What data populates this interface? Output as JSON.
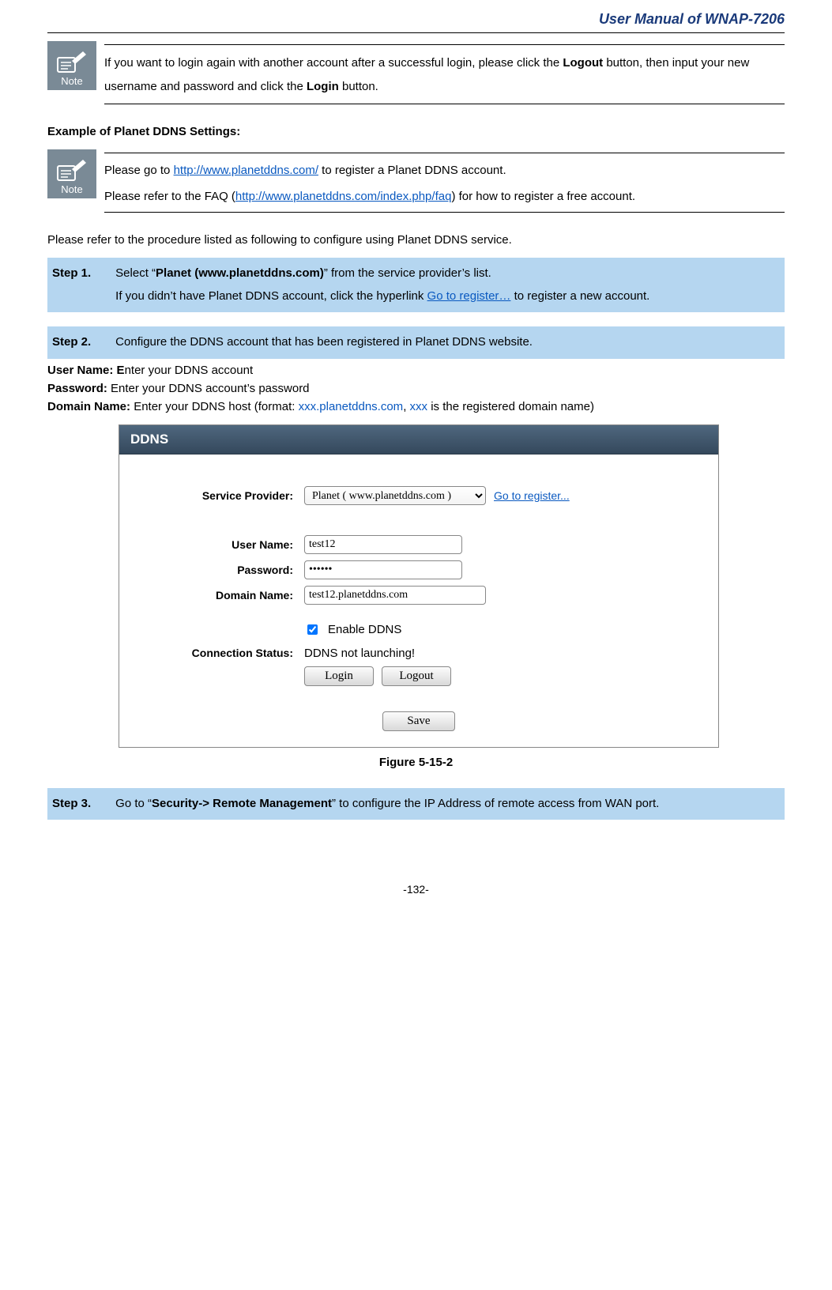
{
  "header": {
    "doc_title": "User Manual of WNAP-7206"
  },
  "note1": {
    "icon_label": "Note",
    "text_before": "If you want to login again with another account after a successful login, please click the ",
    "logout_word": "Logout",
    "text_mid": " button, then input your new username and password and click the ",
    "login_word": "Login",
    "text_after": " button."
  },
  "section_title": "Example of Planet DDNS Settings:",
  "note2": {
    "icon_label": "Note",
    "line1_before": "Please go to ",
    "line1_link": "http://www.planetddns.com/",
    "line1_after": " to register a Planet DDNS account.",
    "line2_before": "Please refer to the FAQ (",
    "line2_link": "http://www.planetddns.com/index.php/faq",
    "line2_after": ") for how to register a free account."
  },
  "intro_paragraph": "Please refer to the procedure listed as following to configure using Planet DDNS service.",
  "step1": {
    "label": "Step 1.",
    "row1_before": "Select “",
    "row1_bold": "Planet (www.planetddns.com)",
    "row1_after": "” from the service provider’s list.",
    "row2_before": "If you didn’t have Planet DDNS account, click the hyperlink ",
    "row2_link": "Go to register…",
    "row2_after": " to register a new account."
  },
  "step2": {
    "label": "Step 2.",
    "text": "Configure the DDNS account that has been registered in Planet DDNS website."
  },
  "params": {
    "user_label": "User Name: ",
    "user_bold_extra": "E",
    "user_rest": "nter your DDNS account",
    "pwd_label": "Password:",
    "pwd_text": " Enter your DDNS account’s password",
    "dom_label": "Domain Name:",
    "dom_before": " Enter your DDNS host (format: ",
    "dom_blue1": "xxx.planetddns.com",
    "dom_mid": ", ",
    "dom_blue2": "xxx",
    "dom_after": " is the registered domain name)"
  },
  "ddns": {
    "panel_title": "DDNS",
    "labels": {
      "service_provider": "Service Provider:",
      "user_name": "User Name:",
      "password": "Password:",
      "domain_name": "Domain Name:",
      "connection_status": "Connection Status:"
    },
    "provider_value": "Planet ( www.planetddns.com )",
    "goto_register": "Go to register...",
    "user_value": "test12",
    "password_value": "••••••",
    "domain_value": "test12.planetddns.com",
    "enable_label": "Enable DDNS",
    "enable_checked": true,
    "status_value": "DDNS not launching!",
    "login_btn": "Login",
    "logout_btn": "Logout",
    "save_btn": "Save"
  },
  "figure_caption": "Figure 5-15-2",
  "step3": {
    "label": "Step 3.",
    "before": "Go to “",
    "bold": "Security-> Remote Management",
    "after": "” to configure the IP Address of remote access from WAN port."
  },
  "footer": {
    "page_number": "-132-"
  }
}
